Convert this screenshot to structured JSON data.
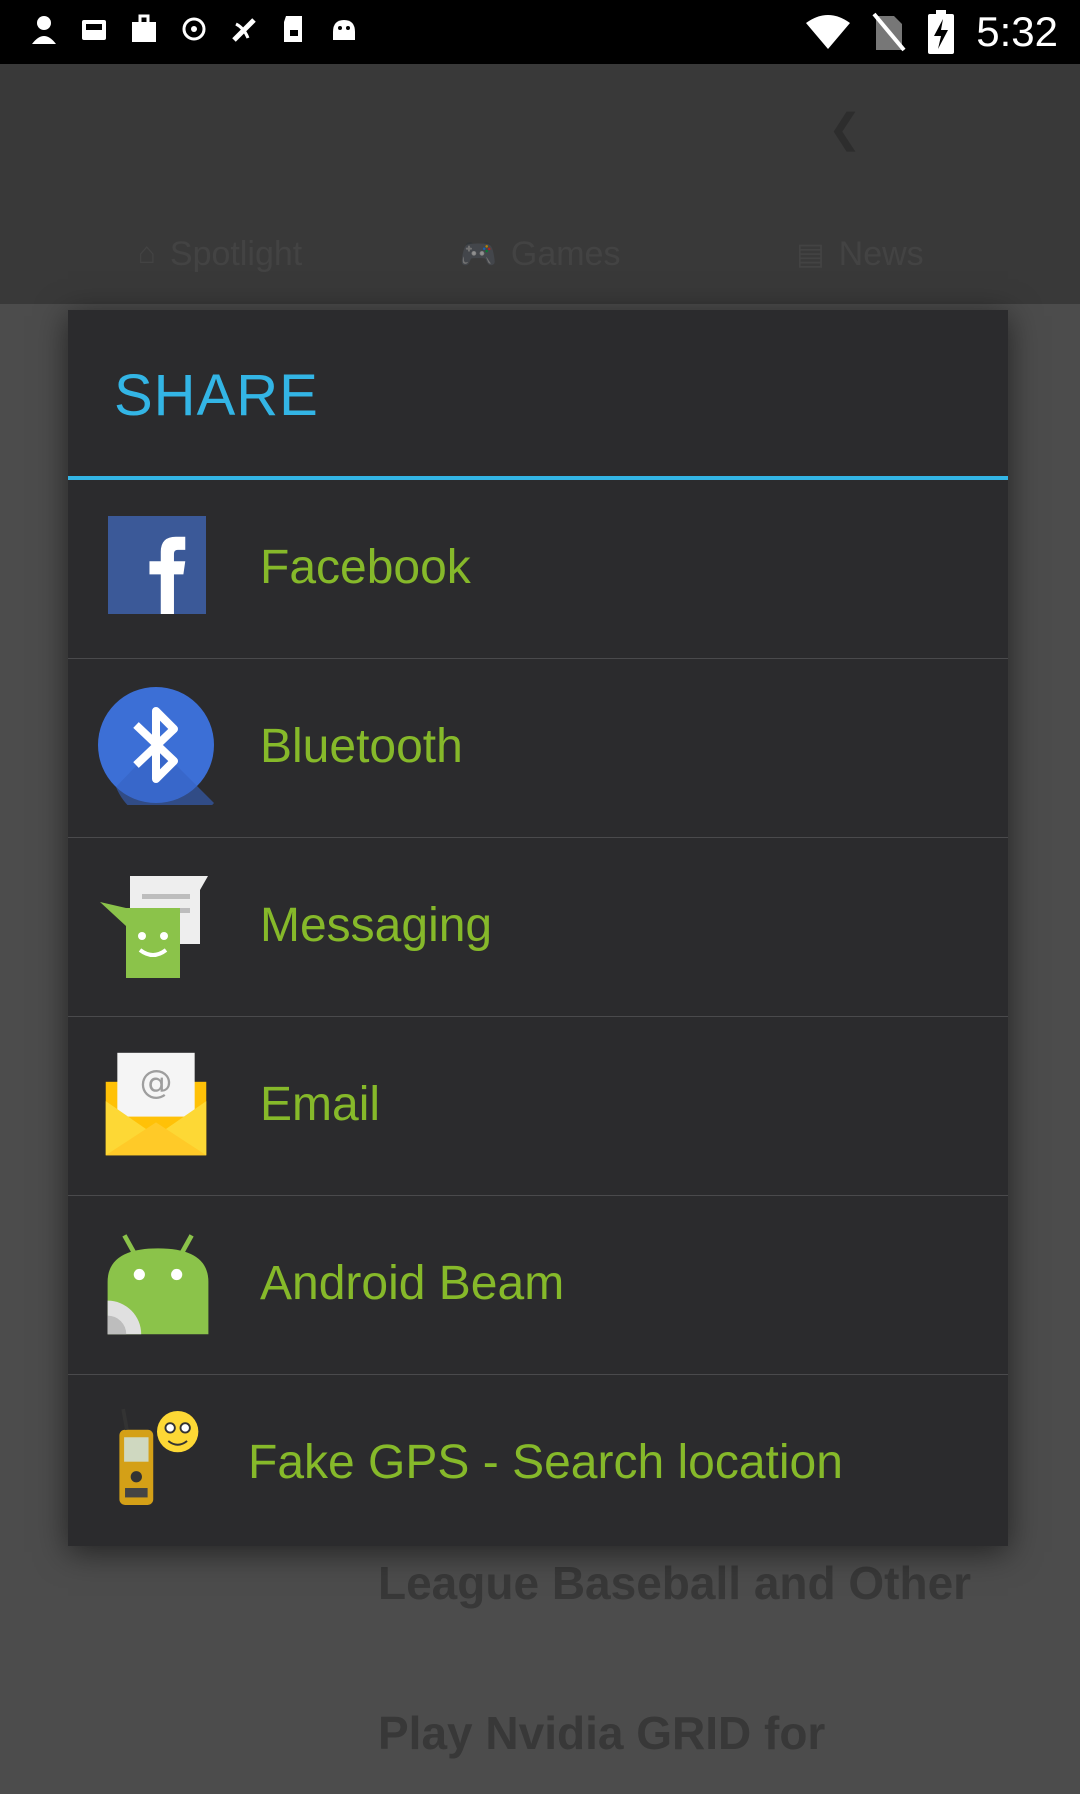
{
  "status_bar": {
    "time": "5:32",
    "notification_icons": [
      "person-icon",
      "inbox-icon",
      "shop-icon",
      "sync-icon",
      "satellite-icon",
      "sd-card-icon",
      "android-icon"
    ],
    "system_icons": [
      "wifi-icon",
      "no-sim-icon",
      "battery-charging-icon"
    ]
  },
  "background": {
    "tabs": [
      {
        "label": "Spotlight",
        "icon": "home-icon"
      },
      {
        "label": "Games",
        "icon": "gamepad-icon"
      },
      {
        "label": "News",
        "icon": "newspaper-icon"
      }
    ],
    "card_title": "League Baseball and Other",
    "card_title_2": "Play Nvidia GRID for"
  },
  "share_dialog": {
    "title": "SHARE",
    "accent_color": "#33b5e5",
    "label_color": "#86b92a",
    "items": [
      {
        "label": "Facebook",
        "icon": "facebook-icon"
      },
      {
        "label": "Bluetooth",
        "icon": "bluetooth-icon"
      },
      {
        "label": "Messaging",
        "icon": "messaging-icon"
      },
      {
        "label": "Email",
        "icon": "email-icon"
      },
      {
        "label": "Android Beam",
        "icon": "android-beam-icon"
      },
      {
        "label": "Fake GPS - Search location",
        "icon": "fake-gps-icon"
      }
    ]
  }
}
